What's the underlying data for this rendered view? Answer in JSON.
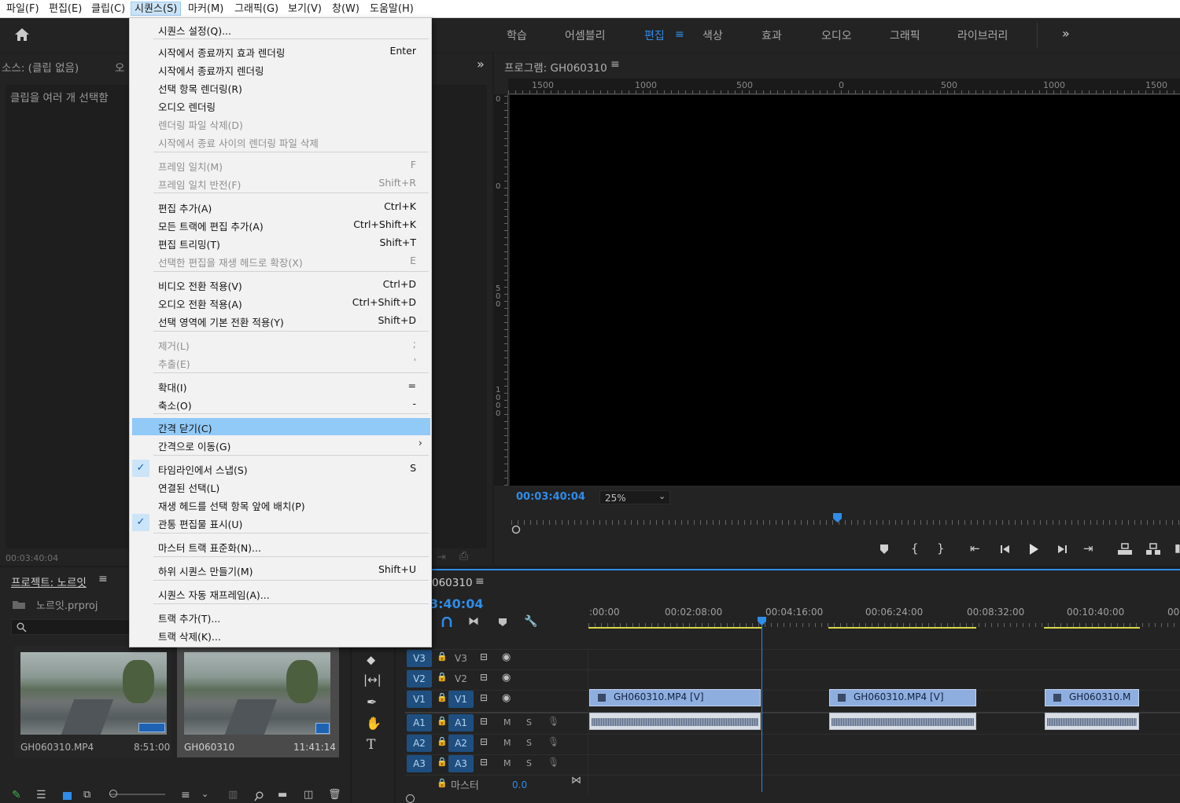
{
  "menubar": {
    "items": [
      "파일(F)",
      "편집(E)",
      "클립(C)",
      "시퀀스(S)",
      "마커(M)",
      "그래픽(G)",
      "보기(V)",
      "창(W)",
      "도움말(H)"
    ]
  },
  "workspaces": {
    "tabs": [
      "학습",
      "어셈블리",
      "편집",
      "색상",
      "효과",
      "오디오",
      "그래픽",
      "라이브러리"
    ],
    "active": "편집",
    "more": "»"
  },
  "source_panel": {
    "title": "소스: (클립 없음)",
    "tab2": "오",
    "message": "클립을 여러 개 선택함",
    "timecode": "00:03:40:04"
  },
  "sequence_menu": {
    "items": [
      {
        "label": "시퀀스 설정(Q)...",
        "shortcut": "",
        "disabled": false
      },
      {
        "label": "시작에서 종료까지 효과 렌더링",
        "shortcut": "Enter",
        "disabled": false
      },
      {
        "label": "시작에서 종료까지 렌더링",
        "shortcut": "",
        "disabled": false
      },
      {
        "label": "선택 항목 렌더링(R)",
        "shortcut": "",
        "disabled": false
      },
      {
        "label": "오디오 렌더링",
        "shortcut": "",
        "disabled": false
      },
      {
        "label": "렌더링 파일 삭제(D)",
        "shortcut": "",
        "disabled": true
      },
      {
        "label": "시작에서 종료 사이의 렌더링 파일 삭제",
        "shortcut": "",
        "disabled": true
      },
      {
        "label": "프레임 일치(M)",
        "shortcut": "F",
        "disabled": true
      },
      {
        "label": "프레임 일치 반전(F)",
        "shortcut": "Shift+R",
        "disabled": true
      },
      {
        "label": "편집 추가(A)",
        "shortcut": "Ctrl+K",
        "disabled": false
      },
      {
        "label": "모든 트랙에 편집 추가(A)",
        "shortcut": "Ctrl+Shift+K",
        "disabled": false
      },
      {
        "label": "편집 트리밍(T)",
        "shortcut": "Shift+T",
        "disabled": false
      },
      {
        "label": "선택한 편집을 재생 헤드로 확장(X)",
        "shortcut": "E",
        "disabled": true
      },
      {
        "label": "비디오 전환 적용(V)",
        "shortcut": "Ctrl+D",
        "disabled": false
      },
      {
        "label": "오디오 전환 적용(A)",
        "shortcut": "Ctrl+Shift+D",
        "disabled": false
      },
      {
        "label": "선택 영역에 기본 전환 적용(Y)",
        "shortcut": "Shift+D",
        "disabled": false
      },
      {
        "label": "제거(L)",
        "shortcut": ";",
        "disabled": true
      },
      {
        "label": "추출(E)",
        "shortcut": "'",
        "disabled": true
      },
      {
        "label": "확대(I)",
        "shortcut": "=",
        "disabled": false
      },
      {
        "label": "축소(O)",
        "shortcut": "-",
        "disabled": false
      },
      {
        "label": "간격 닫기(C)",
        "shortcut": "",
        "disabled": false,
        "highlighted": true
      },
      {
        "label": "간격으로 이동(G)",
        "shortcut": "",
        "disabled": false,
        "submenu": true
      },
      {
        "label": "타임라인에서 스냅(S)",
        "shortcut": "S",
        "disabled": false,
        "checked": true
      },
      {
        "label": "연결된 선택(L)",
        "shortcut": "",
        "disabled": false
      },
      {
        "label": "재생 헤드를 선택 항목 앞에 배치(P)",
        "shortcut": "",
        "disabled": false
      },
      {
        "label": "관통 편집물 표시(U)",
        "shortcut": "",
        "disabled": false,
        "checked": true
      },
      {
        "label": "마스터 트랙 표준화(N)...",
        "shortcut": "",
        "disabled": false
      },
      {
        "label": "하위 시퀀스 만들기(M)",
        "shortcut": "Shift+U",
        "disabled": false
      },
      {
        "label": "시퀀스 자동 재프레임(A)...",
        "shortcut": "",
        "disabled": false
      },
      {
        "label": "트랙 추가(T)...",
        "shortcut": "",
        "disabled": false
      },
      {
        "label": "트랙 삭제(K)...",
        "shortcut": "",
        "disabled": false
      }
    ]
  },
  "program_monitor": {
    "title": "프로그램: GH060310",
    "ruler_top": [
      "1500",
      "1000",
      "500",
      "0",
      "500",
      "1000",
      "1500"
    ],
    "ruler_left": [
      "0",
      "0",
      "5\n0\n0",
      "1\n0\n0\n0"
    ],
    "timecode": "00:03:40:04",
    "zoom": "25%"
  },
  "project_panel": {
    "title": "프로젝트: 노르잇",
    "file": "노르잇.prproj",
    "items": [
      {
        "name": "GH060310.MP4",
        "duration": "8:51:00"
      },
      {
        "name": "GH060310",
        "duration": "11:41:14"
      }
    ]
  },
  "timeline": {
    "title": "060310",
    "timecode": "3:40:04",
    "ruler": [
      ":00:00",
      "00:02:08:00",
      "00:04:16:00",
      "00:06:24:00",
      "00:08:32:00",
      "00:10:40:00",
      "00"
    ],
    "tracks": {
      "video": [
        {
          "src": "V3",
          "tgt": "V3"
        },
        {
          "src": "V2",
          "tgt": "V2"
        },
        {
          "src": "V1",
          "tgt": "V1"
        }
      ],
      "audio": [
        {
          "src": "A1",
          "tgt": "A1"
        },
        {
          "src": "A2",
          "tgt": "A2"
        },
        {
          "src": "A3",
          "tgt": "A3"
        }
      ]
    },
    "m_label": "M",
    "s_label": "S",
    "master_label": "마스터",
    "master_value": "0.0",
    "clips": [
      "GH060310.MP4 [V]",
      "GH060310.MP4 [V]",
      "GH060310.M"
    ]
  },
  "colors": {
    "accent": "#2f8ce8",
    "menu_highlight": "#91c9f7",
    "track_button": "#1e4f80",
    "clip_video": "#8faee0"
  }
}
